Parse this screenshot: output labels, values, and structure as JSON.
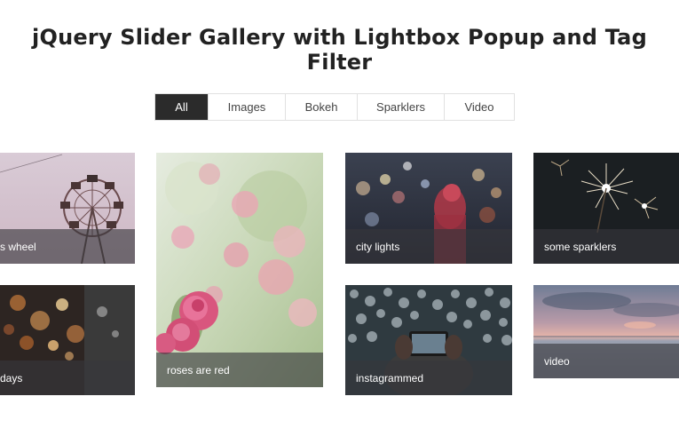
{
  "header": {
    "title": "jQuery Slider Gallery with Lightbox Popup and Tag Filter"
  },
  "filters": {
    "items": [
      {
        "label": "All",
        "active": true
      },
      {
        "label": "Images",
        "active": false
      },
      {
        "label": "Bokeh",
        "active": false
      },
      {
        "label": "Sparklers",
        "active": false
      },
      {
        "label": "Video",
        "active": false
      }
    ]
  },
  "gallery": {
    "items": [
      {
        "caption": "s wheel",
        "image": "ferris-wheel-photo"
      },
      {
        "caption": "days",
        "image": "dark-bokeh-photo"
      },
      {
        "caption": "roses are red",
        "image": "pink-roses-photo"
      },
      {
        "caption": "city lights",
        "image": "city-lights-photo"
      },
      {
        "caption": "instagrammed",
        "image": "phone-bokeh-photo"
      },
      {
        "caption": "some sparklers",
        "image": "sparklers-photo"
      },
      {
        "caption": "video",
        "image": "sunset-sea-photo"
      }
    ]
  },
  "colors": {
    "active_filter_bg": "#2b2b2b",
    "caption_overlay": "#37373c",
    "title_text": "#222222"
  }
}
